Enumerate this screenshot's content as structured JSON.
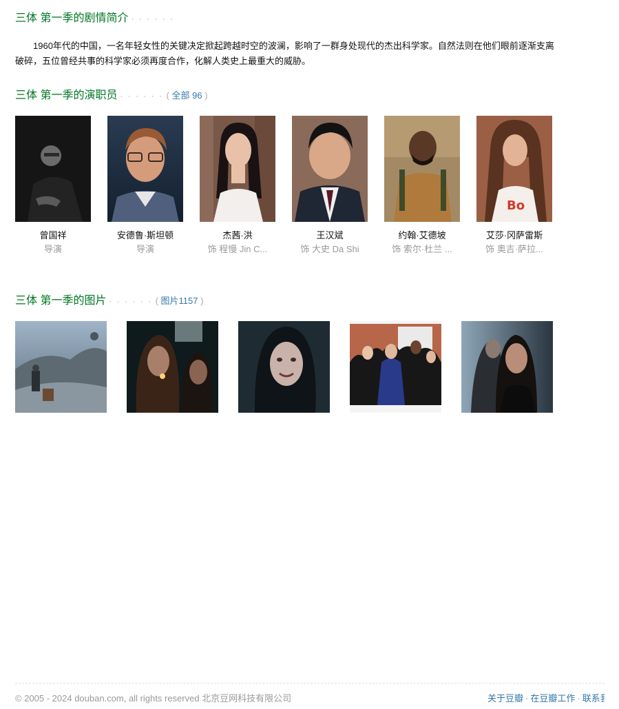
{
  "synopsis": {
    "title": "三体 第一季的剧情简介",
    "dots": "· · · · · ·",
    "text": "1960年代的中国，一名年轻女性的关键决定掀起跨越时空的波澜，影响了一群身处现代的杰出科学家。自然法则在他们眼前逐渐支离破碎，五位曾经共事的科学家必须再度合作，化解人类史上最重大的威胁。"
  },
  "cast": {
    "title": "三体 第一季的演职员",
    "dots": "· · · · · ·",
    "more_prefix": "( ",
    "more_link": "全部 96",
    "more_suffix": " )",
    "members": [
      {
        "name": "曾国祥",
        "role": "导演",
        "avatar": "portrait-dark"
      },
      {
        "name": "安德鲁·斯坦顿",
        "role": "导演",
        "avatar": "portrait-glasses"
      },
      {
        "name": "杰茜·洪",
        "role": "饰 程慢 Jin C...",
        "avatar": "portrait-woman"
      },
      {
        "name": "王汉斌",
        "role": "饰 大史 Da Shi",
        "avatar": "portrait-suit"
      },
      {
        "name": "约翰·艾德坡",
        "role": "饰 索尔·杜兰 ...",
        "avatar": "portrait-beard"
      },
      {
        "name": "艾莎·冈萨雷斯",
        "role": "饰 奥吉·萨拉...",
        "avatar": "portrait-woman-long-hair"
      }
    ]
  },
  "photos": {
    "title": "三体 第一季的图片",
    "dots": "· · · · · ·",
    "more_prefix": "( ",
    "more_link": "图片1157",
    "more_suffix": " )",
    "items": [
      {
        "scene": "rocky-landscape"
      },
      {
        "scene": "lighting-cigarette"
      },
      {
        "scene": "woman-crying"
      },
      {
        "scene": "graduation-group"
      },
      {
        "scene": "woman-portrait"
      }
    ]
  },
  "footer": {
    "copyright": "© 2005 - 2024 douban.com, all rights reserved 北京豆网科技有限公司",
    "links": [
      "关于豆瓣",
      "在豆瓣工作",
      "联系我们"
    ]
  }
}
